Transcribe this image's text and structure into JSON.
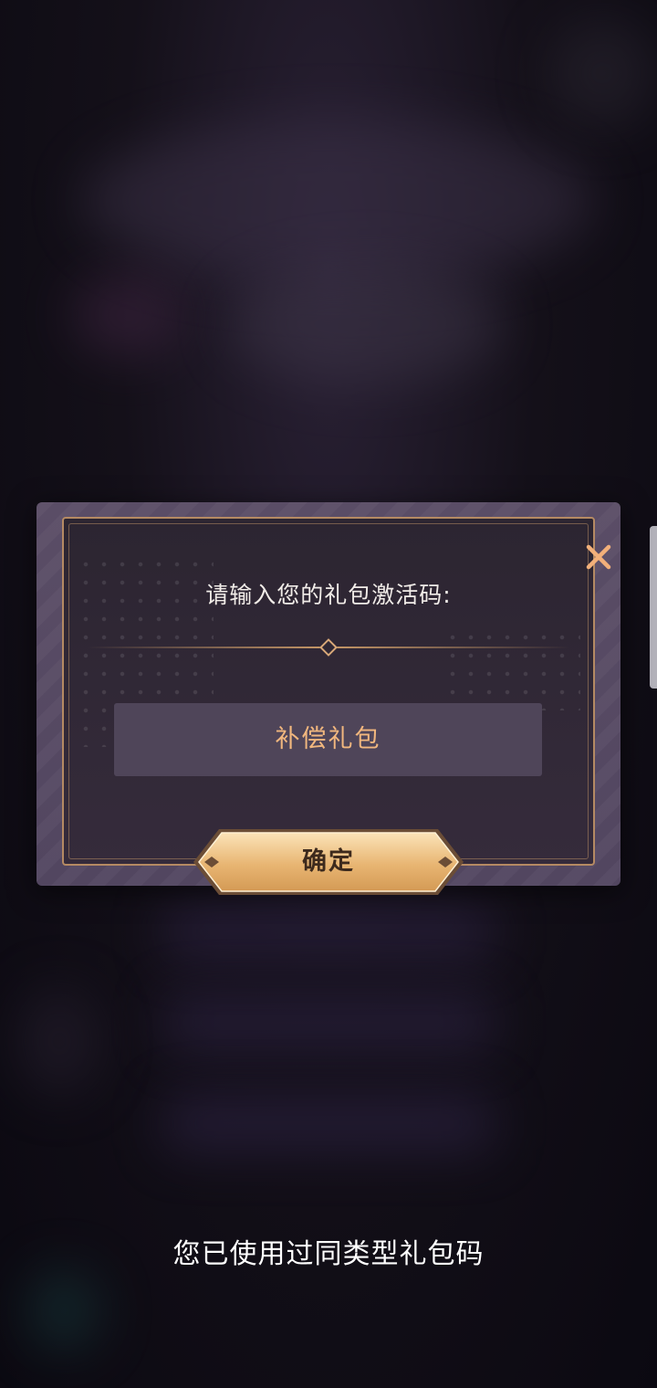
{
  "dialog": {
    "prompt": "请输入您的礼包激活码:",
    "code_value": "补偿礼包",
    "confirm_label": "确定",
    "close_icon": "close-icon"
  },
  "toast": {
    "message": "您已使用过同类型礼包码"
  },
  "colors": {
    "accent_gold": "#f1b77e",
    "frame": "#b58a63",
    "close_icon": "#f2b07a"
  }
}
